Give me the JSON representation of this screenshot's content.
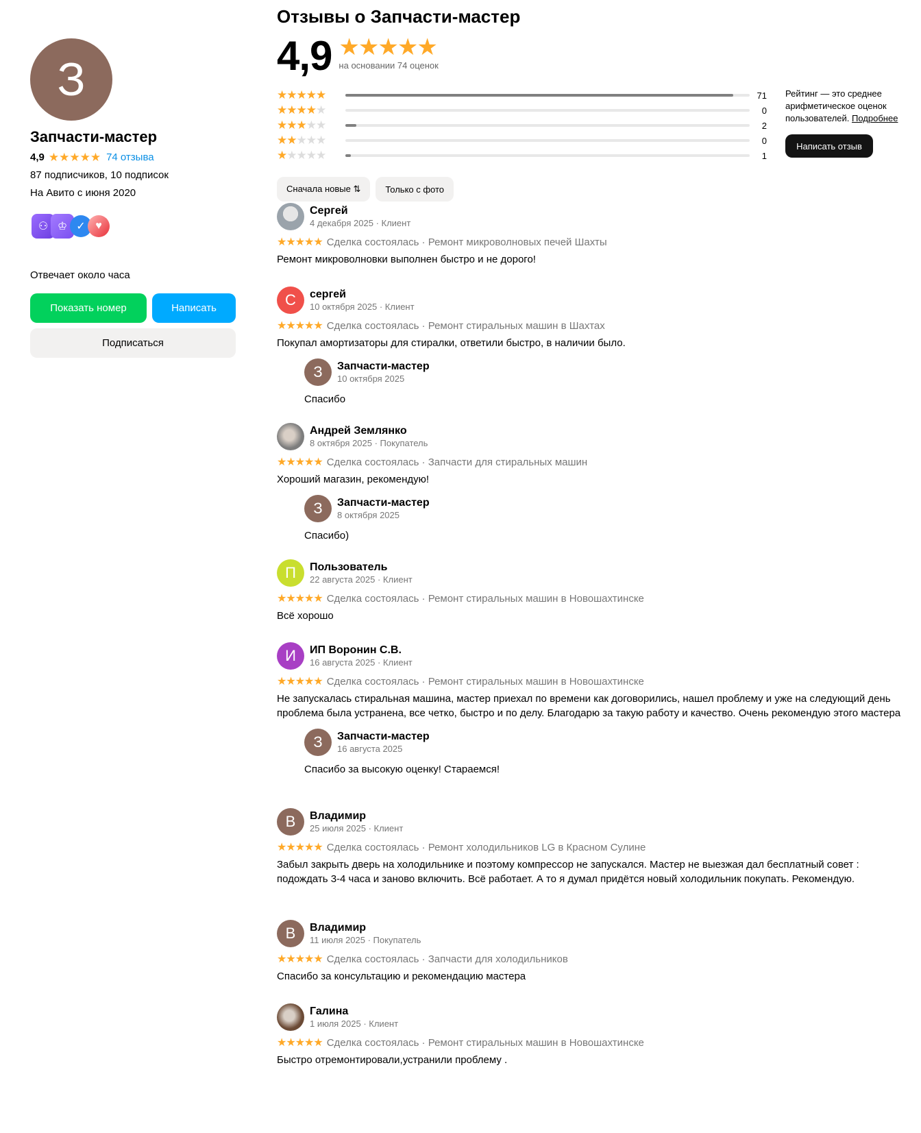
{
  "sidebar": {
    "avatar_letter": "З",
    "name": "Запчасти-мастер",
    "rating": "4,9",
    "stars": "★★★★★",
    "reviews_link": "74 отзыва",
    "subs": "87 подписчиков, 10 подписок",
    "since": "На Авито с июня 2020",
    "responds": "Отвечает около часа",
    "btn_phone": "Показать номер",
    "btn_write": "Написать",
    "btn_subscribe": "Подписаться"
  },
  "main": {
    "title": "Отзывы о Запчасти-мастер",
    "rating": "4,9",
    "stars": "★★★★★",
    "based_on": "на основании 74 оценок",
    "info_text": "Рейтинг — это среднее арифметическое оценок пользователей.",
    "info_link": "Подробнее",
    "write_review": "Написать отзыв",
    "filter_new": "Сначала новые ⇅",
    "filter_photo": "Только с фото"
  },
  "distribution": [
    {
      "stars": 5,
      "count": "71",
      "share": 0.96
    },
    {
      "stars": 4,
      "count": "0",
      "share": 0.0
    },
    {
      "stars": 3,
      "count": "2",
      "share": 0.027
    },
    {
      "stars": 2,
      "count": "0",
      "share": 0.0
    },
    {
      "stars": 1,
      "count": "1",
      "share": 0.013
    }
  ],
  "colors": {
    "accent_star": "#ffa928",
    "green": "#02d15c",
    "blue": "#00aaff",
    "shop_avatar": "#8c6a5d"
  },
  "reviews": [
    {
      "name": "Сергей",
      "date": "4 декабря 2025 · Клиент",
      "avatar": "",
      "avatar_color": "#b7bcc2",
      "deal": "Сделка состоялась · Ремонт микроволновых печей Шахты",
      "text": "Ремонт микроволновки выполнен быстро и не дорого!"
    },
    {
      "name": "сергей",
      "date": "10 октября 2025 · Клиент",
      "avatar": "С",
      "avatar_color": "#f0504a",
      "deal": "Сделка состоялась · Ремонт стиральных машин в Шахтах",
      "text": "Покупал амортизаторы для стиралки, ответили быстро, в наличии было.",
      "reply": {
        "name": "Запчасти-мастер",
        "date": "10 октября 2025",
        "text": "Спасибо"
      }
    },
    {
      "name": "Андрей Землянко",
      "date": "8 октября 2025 · Покупатель",
      "avatar": "",
      "avatar_color": "#7d7d7d",
      "deal": "Сделка состоялась · Запчасти для стиральных машин",
      "text": "Хороший магазин, рекомендую!",
      "reply": {
        "name": "Запчасти-мастер",
        "date": "8 октября 2025",
        "text": "Спасибо)"
      }
    },
    {
      "name": "Пользователь",
      "date": "22 августа 2025 · Клиент",
      "avatar": "П",
      "avatar_color": "#c9de2f",
      "deal": "Сделка состоялась · Ремонт стиральных машин в Новошахтинске",
      "text": "Всё хорошо"
    },
    {
      "name": "ИП Воронин С.В.",
      "date": "16 августа 2025 · Клиент",
      "avatar": "И",
      "avatar_color": "#a83fc4",
      "deal": "Сделка состоялась · Ремонт стиральных машин в Новошахтинске",
      "text": "Не запускалась стиральная машина, мастер приехал по времени как договорились, нашел проблему и уже на следующий день проблема была устранена, все четко, быстро и по делу. Благодарю за такую работу и качество. Очень рекомендую этого мастера",
      "reply": {
        "name": "Запчасти-мастер",
        "date": "16 августа 2025",
        "text": "Спасибо за высокую оценку! Стараемся!"
      }
    },
    {
      "name": "Владимир",
      "date": "25 июля 2025 · Клиент",
      "avatar": "В",
      "avatar_color": "#8c6a5d",
      "deal": "Сделка состоялась · Ремонт холодильников LG в Красном Сулине",
      "text": "Забыл закрыть дверь на холодильнике и поэтому компрессор не запускался. Мастер не выезжая дал бесплатный совет : подождать 3-4 часа и заново включить. Всё работает. А то я думал придётся новый холодильник покупать. Рекомендую."
    },
    {
      "name": "Владимир",
      "date": "11 июля 2025 · Покупатель",
      "avatar": "В",
      "avatar_color": "#8c6a5d",
      "deal": "Сделка состоялась · Запчасти для холодильников",
      "text": "Спасибо за консультацию и рекомендацию мастера"
    },
    {
      "name": "Галина",
      "date": "1 июля 2025 · Клиент",
      "avatar": "",
      "avatar_color": "#6b4a35",
      "deal": "Сделка состоялась · Ремонт стиральных машин в Новошахтинске",
      "text": "Быстро отремонтировали,устранили проблему ."
    }
  ]
}
